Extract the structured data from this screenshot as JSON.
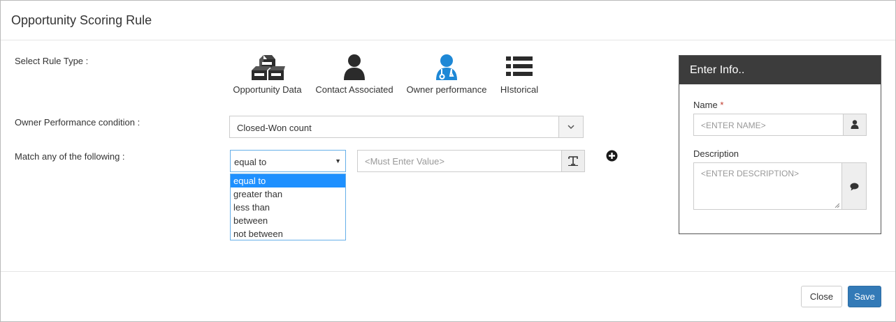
{
  "modal": {
    "title": "Opportunity Scoring Rule"
  },
  "labels": {
    "rule_type": "Select Rule Type :",
    "condition": "Owner Performance condition :",
    "match": "Match any of the following :"
  },
  "rule_types": [
    {
      "label": "Opportunity Data",
      "icon": "cubes-icon",
      "active": false
    },
    {
      "label": "Contact Associated",
      "icon": "user-icon",
      "active": false
    },
    {
      "label": "Owner performance",
      "icon": "user-md-icon",
      "active": true
    },
    {
      "label": "HIstorical",
      "icon": "list-icon",
      "active": false
    }
  ],
  "condition_select": {
    "value": "Closed-Won count"
  },
  "operator_select": {
    "value": "equal to",
    "options": [
      "equal to",
      "greater than",
      "less than",
      "between",
      "not between"
    ],
    "selected_index": 0
  },
  "value_input": {
    "placeholder": "<Must Enter Value>"
  },
  "info_panel": {
    "title": "Enter Info..",
    "name_label": "Name",
    "required_mark": "*",
    "name_placeholder": "<ENTER NAME>",
    "description_label": "Description",
    "description_placeholder": "<ENTER DESCRIPTION>"
  },
  "footer": {
    "close_label": "Close",
    "save_label": "Save"
  },
  "colors": {
    "accent": "#337ab7",
    "active_icon": "#1e88d6",
    "selected_option": "#1e90ff",
    "panel_header": "#3c3c3c"
  }
}
